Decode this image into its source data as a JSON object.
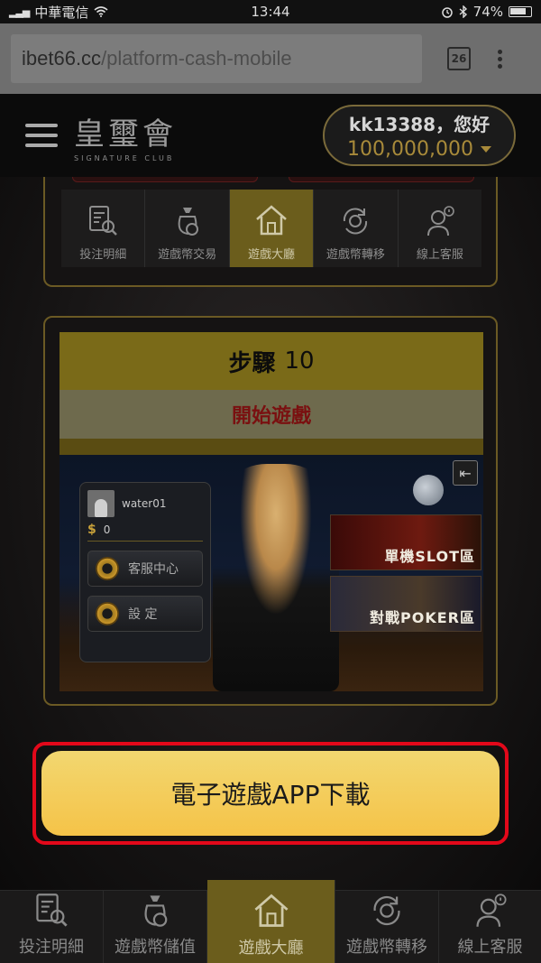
{
  "status_bar": {
    "carrier": "中華電信",
    "time": "13:44",
    "battery": "74%"
  },
  "browser": {
    "url_host": "ibet66.cc",
    "url_path": "/platform-cash-mobile",
    "tab_count": "26"
  },
  "header": {
    "brand_name": "皇璽會",
    "brand_sub": "SIGNATURE CLUB",
    "greeting": "kk13388，您好",
    "balance": "100,000,000"
  },
  "top_menu": [
    {
      "label": "投注明細",
      "icon": "receipt-search-icon"
    },
    {
      "label": "遊戲幣交易",
      "icon": "money-bag-icon"
    },
    {
      "label": "遊戲大廳",
      "icon": "home-icon",
      "active": true
    },
    {
      "label": "遊戲幣轉移",
      "icon": "coin-transfer-icon"
    },
    {
      "label": "線上客服",
      "icon": "support-agent-icon"
    }
  ],
  "step": {
    "label": "步驟",
    "number": "10",
    "subtitle": "開始遊戲"
  },
  "game": {
    "username": "water01",
    "coin_symbol": "$",
    "coins": "0",
    "service_button": "客服中心",
    "settings_button": "設 定",
    "banner_slot": "單機SLOT區",
    "banner_poker": "對戰POKER區"
  },
  "cta": {
    "label": "電子遊戲APP下載"
  },
  "bottom_nav": [
    {
      "label": "投注明細",
      "icon": "receipt-search-icon"
    },
    {
      "label": "遊戲幣儲值",
      "icon": "money-bag-icon"
    },
    {
      "label": "遊戲大廳",
      "icon": "home-icon",
      "active": true
    },
    {
      "label": "遊戲幣轉移",
      "icon": "coin-transfer-icon"
    },
    {
      "label": "線上客服",
      "icon": "support-agent-icon"
    }
  ],
  "colors": {
    "gold": "#7a6a18",
    "active_tab": "#6b5d1c",
    "cta": "#f5c348",
    "highlight": "#e3081a",
    "subtitle_text": "#7a1010"
  }
}
